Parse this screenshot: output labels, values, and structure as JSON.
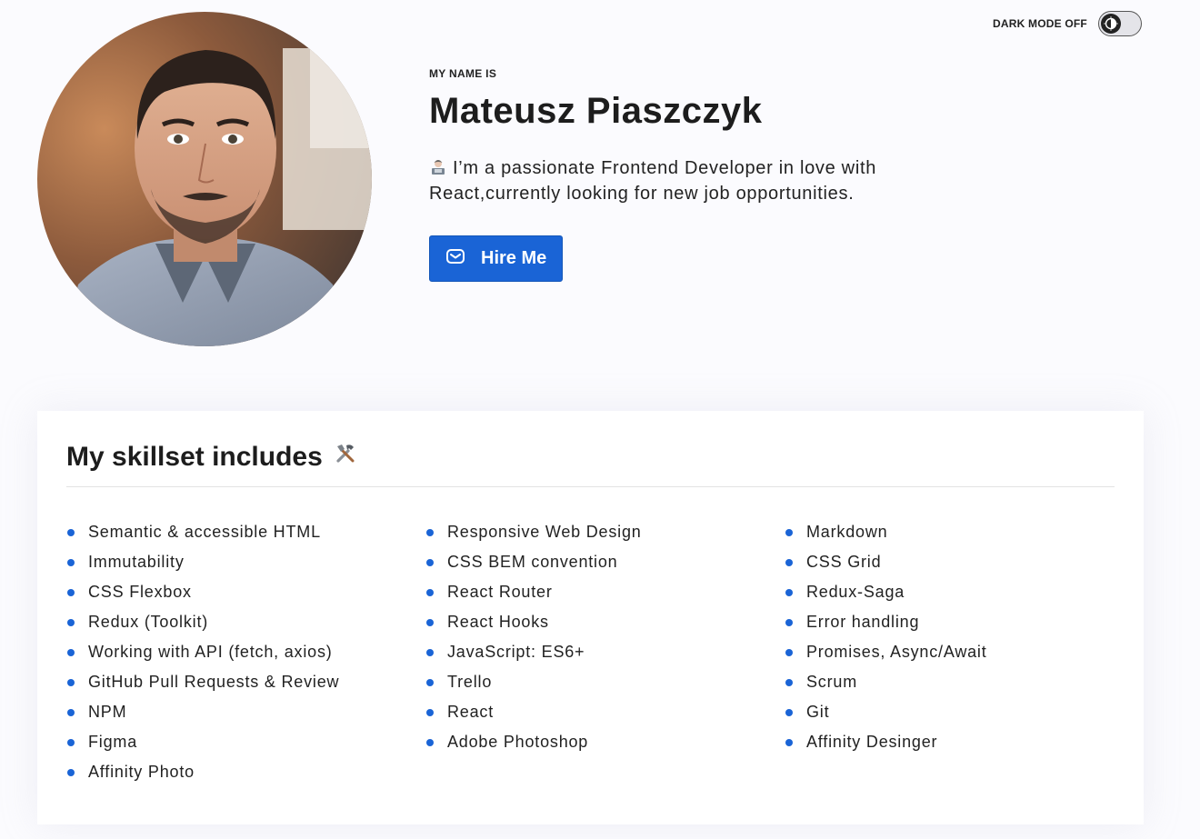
{
  "theme": {
    "label": "DARK MODE OFF",
    "icon": "contrast-icon",
    "enabled": false
  },
  "profile": {
    "eyebrow": "MY NAME IS",
    "name": "Mateusz Piaszczyk",
    "bio_emoji": "technologist-emoji",
    "bio": "I’m a passionate Frontend Developer in love with React,currently looking for new job opportunities.",
    "hire_label": "Hire Me",
    "hire_icon": "mail-icon",
    "photo": "profile-photo"
  },
  "skills": {
    "title": "My skillset includes",
    "title_icon": "tools-icon",
    "columns": [
      [
        "Semantic & accessible HTML",
        "Immutability",
        "CSS Flexbox",
        "Redux (Toolkit)",
        "Working with API (fetch, axios)",
        "GitHub Pull Requests & Review",
        "NPM",
        "Figma",
        "Affinity Photo"
      ],
      [
        "Responsive Web Design",
        "CSS BEM convention",
        "React Router",
        "React Hooks",
        "JavaScript: ES6+",
        "Trello",
        "React",
        "Adobe Photoshop"
      ],
      [
        "Markdown",
        "CSS Grid",
        "Redux-Saga",
        "Error handling",
        "Promises, Async/Await",
        "Scrum",
        "Git",
        "Affinity Desinger"
      ]
    ]
  },
  "colors": {
    "accent": "#1a64d6",
    "background": "#fbfbfe",
    "card": "#ffffff",
    "text": "#222222"
  }
}
